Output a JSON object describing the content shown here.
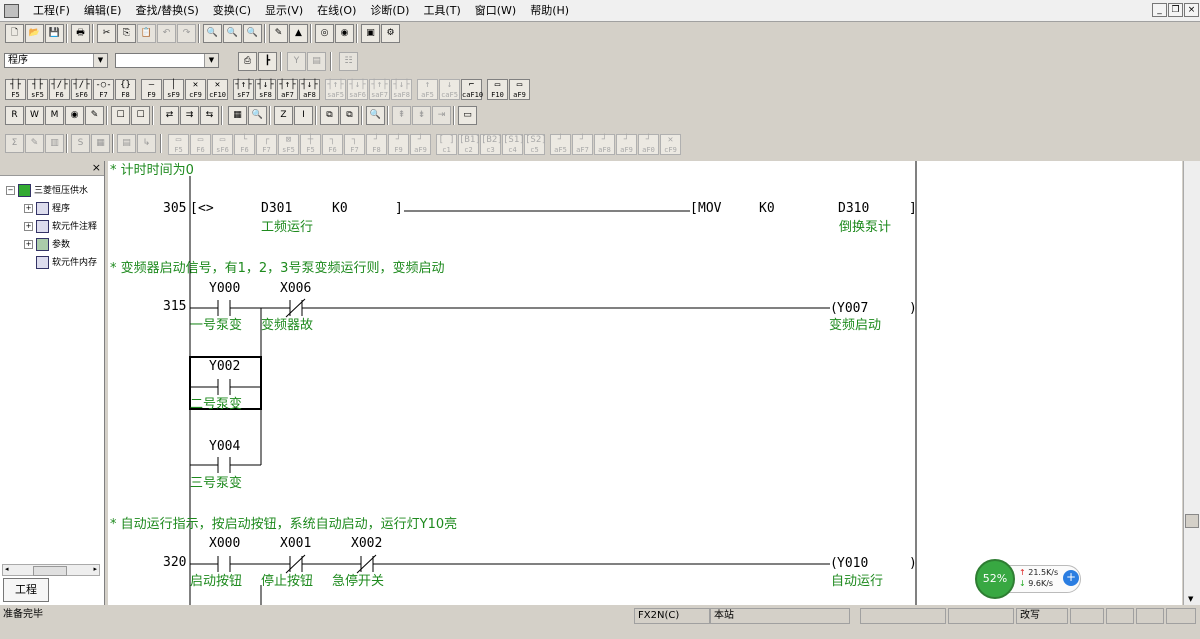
{
  "menubar": {
    "items": [
      "工程(F)",
      "编辑(E)",
      "查找/替换(S)",
      "变换(C)",
      "显示(V)",
      "在线(O)",
      "诊断(D)",
      "工具(T)",
      "窗口(W)",
      "帮助(H)"
    ],
    "window_controls": [
      "_",
      "❐",
      "×"
    ]
  },
  "toolbar": {
    "mode_select": "程序",
    "second_select": ""
  },
  "fkeys": [
    {
      "sym": "┤├",
      "label": "F5"
    },
    {
      "sym": "┤├",
      "label": "sF5"
    },
    {
      "sym": "┤/├",
      "label": "F6"
    },
    {
      "sym": "┤/├",
      "label": "sF6"
    },
    {
      "sym": "-○-",
      "label": "F7"
    },
    {
      "sym": "{}",
      "label": "F8"
    },
    {
      "sym": "—",
      "label": "F9"
    },
    {
      "sym": "│",
      "label": "sF9"
    },
    {
      "sym": "✕",
      "label": "cF9"
    },
    {
      "sym": "✕",
      "label": "cF10"
    },
    {
      "sym": "┤↑├",
      "label": "sF7"
    },
    {
      "sym": "┤↓├",
      "label": "sF8"
    },
    {
      "sym": "┤↑├",
      "label": "aF7"
    },
    {
      "sym": "┤↓├",
      "label": "aF8"
    },
    {
      "sym": "┤↑├",
      "label": "saF5"
    },
    {
      "sym": "┤↓├",
      "label": "saF6"
    },
    {
      "sym": "┤↑├",
      "label": "saF7"
    },
    {
      "sym": "┤↓├",
      "label": "saF8"
    },
    {
      "sym": "↑",
      "label": "aF5"
    },
    {
      "sym": "↓",
      "label": "caF5"
    },
    {
      "sym": "⌐",
      "label": "caF10"
    },
    {
      "sym": "▭",
      "label": "F10"
    },
    {
      "sym": "▭",
      "label": "aF9"
    }
  ],
  "fkeys_row5": [
    {
      "sym": "▭",
      "label": "F5"
    },
    {
      "sym": "▭",
      "label": "F6"
    },
    {
      "sym": "▭",
      "label": "sF6"
    },
    {
      "sym": "└",
      "label": "F6"
    },
    {
      "sym": "┌",
      "label": "F7"
    },
    {
      "sym": "⊠",
      "label": "sF5"
    },
    {
      "sym": "┼",
      "label": "F5"
    },
    {
      "sym": "┐",
      "label": "F6"
    },
    {
      "sym": "┐",
      "label": "F7"
    },
    {
      "sym": "┘",
      "label": "F8"
    },
    {
      "sym": "┘",
      "label": "F9"
    },
    {
      "sym": "┘",
      "label": "aF9"
    },
    {
      "sym": "[ ]",
      "label": "c1"
    },
    {
      "sym": "[B1]",
      "label": "c2"
    },
    {
      "sym": "[B2]",
      "label": "c3"
    },
    {
      "sym": "[S1]",
      "label": "c4"
    },
    {
      "sym": "[S2]",
      "label": "c5"
    },
    {
      "sym": "┘",
      "label": "aF5"
    },
    {
      "sym": "┘",
      "label": "aF7"
    },
    {
      "sym": "┘",
      "label": "aF8"
    },
    {
      "sym": "┘",
      "label": "aF9"
    },
    {
      "sym": "┘",
      "label": "aF0"
    },
    {
      "sym": "✕",
      "label": "cF9"
    }
  ],
  "project_panel": {
    "close": "×",
    "tree": [
      {
        "label": "三菱恒压供水",
        "box": "日"
      },
      {
        "label": "程序",
        "box": "田"
      },
      {
        "label": "软元件注释",
        "box": "田"
      },
      {
        "label": "参数",
        "box": "田"
      },
      {
        "label": "软元件内存",
        "box": ""
      }
    ],
    "tab_label": "工程"
  },
  "ladder": {
    "comments": [
      "* 计时时间为0",
      "* 变频器启动信号，有1，2，3号泵变频运行则，变频启动",
      "* 自动运行指示，按启动按钮，系统自动启动，运行灯Y10亮"
    ],
    "step_numbers": [
      "305",
      "315",
      "320"
    ],
    "rung305": {
      "compare_op": "<>",
      "operand1": "D301",
      "operand2": "K0",
      "operand1_comment": "工频运行",
      "instruction": "MOV",
      "src": "K0",
      "dst": "D310",
      "dst_comment": "倒换泵计"
    },
    "rung315": {
      "contacts": [
        {
          "device": "Y000",
          "comment": "一号泵变"
        },
        {
          "device": "X006",
          "comment": "变频器故"
        },
        {
          "device": "Y002",
          "comment": "二号泵变"
        },
        {
          "device": "Y004",
          "comment": "三号泵变"
        }
      ],
      "coil": "Y007",
      "coil_comment": "变频启动"
    },
    "rung320": {
      "contacts": [
        {
          "device": "X000",
          "comment": "启动按钮"
        },
        {
          "device": "X001",
          "comment": "停止按钮"
        },
        {
          "device": "X002",
          "comment": "急停开关"
        }
      ],
      "coil": "Y010",
      "coil_comment": "自动运行"
    }
  },
  "statusbar": {
    "status": "准备完毕",
    "plc": "FX2N(C)",
    "station": "本站",
    "mode": "改写"
  },
  "net_widget": {
    "percent": "52%",
    "upload": "21.5K/s",
    "download": "9.6K/s",
    "plus": "+"
  }
}
